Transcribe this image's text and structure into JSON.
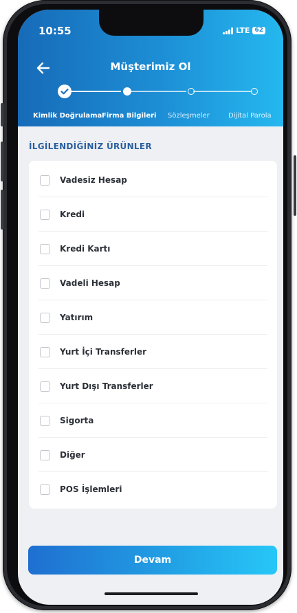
{
  "status_bar": {
    "time": "10:55",
    "network": "LTE",
    "battery": "62"
  },
  "header": {
    "title": "Müşterimiz Ol"
  },
  "steps": [
    {
      "label": "Kimlik Doğrulama",
      "state": "done"
    },
    {
      "label": "Firma Bilgileri",
      "state": "active"
    },
    {
      "label": "Sözleşmeler",
      "state": "pending"
    },
    {
      "label": "Dijital Parola",
      "state": "pending"
    }
  ],
  "section": {
    "title": "İLGİLENDİĞİNİZ ÜRÜNLER"
  },
  "products": [
    {
      "label": "Vadesiz Hesap",
      "checked": false
    },
    {
      "label": "Kredi",
      "checked": false
    },
    {
      "label": "Kredi Kartı",
      "checked": false
    },
    {
      "label": "Vadeli Hesap",
      "checked": false
    },
    {
      "label": "Yatırım",
      "checked": false
    },
    {
      "label": "Yurt İçi Transferler",
      "checked": false
    },
    {
      "label": "Yurt Dışı Transferler",
      "checked": false
    },
    {
      "label": "Sigorta",
      "checked": false
    },
    {
      "label": "Diğer",
      "checked": false
    },
    {
      "label": "POS İşlemleri",
      "checked": false
    }
  ],
  "footer": {
    "continue_label": "Devam"
  },
  "colors": {
    "header_start": "#176bb8",
    "header_end": "#25b8ef",
    "section_title": "#2a5fa0",
    "background": "#eef0f4"
  }
}
